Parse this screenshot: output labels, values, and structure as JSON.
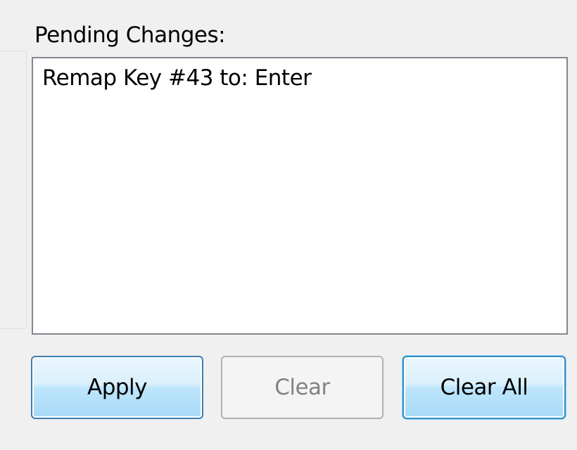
{
  "pending": {
    "label": "Pending Changes:",
    "items": [
      "Remap Key #43 to: Enter"
    ]
  },
  "buttons": {
    "apply": "Apply",
    "clear": "Clear",
    "clear_all": "Clear All"
  },
  "colors": {
    "background": "#f0f0f0",
    "list_border": "#828790",
    "button_border_active": "#3c7fb1",
    "button_disabled_text": "#838383",
    "focus_border": "#2f8ec5"
  }
}
